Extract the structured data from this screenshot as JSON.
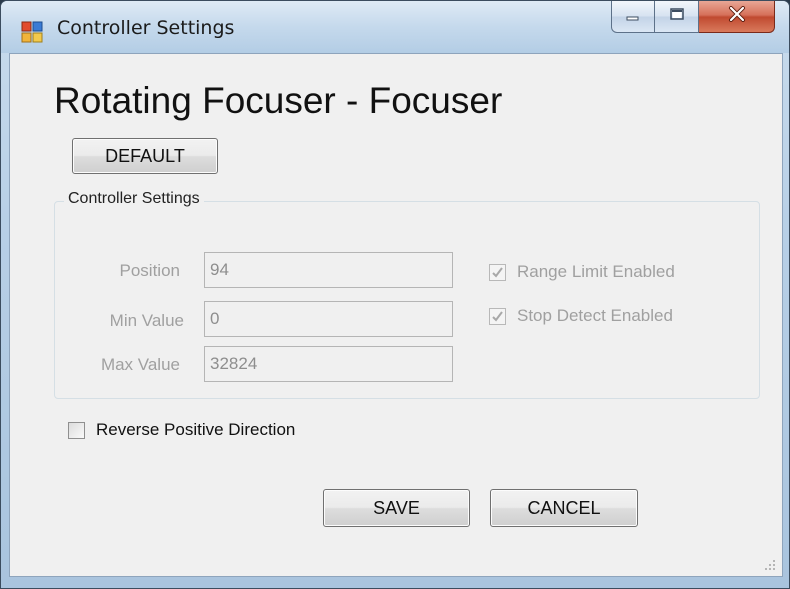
{
  "window": {
    "title": "Controller Settings"
  },
  "main": {
    "heading": "Rotating Focuser - Focuser",
    "default_label": "DEFAULT",
    "group_title": "Controller Settings",
    "fields": [
      {
        "label": "Position",
        "value": "94"
      },
      {
        "label": "Min Value",
        "value": "0"
      },
      {
        "label": "Max Value",
        "value": "32824"
      }
    ],
    "checks": [
      {
        "label": "Range Limit Enabled",
        "checked": true,
        "enabled": false
      },
      {
        "label": "Stop Detect Enabled",
        "checked": true,
        "enabled": false
      }
    ],
    "reverse": {
      "label": "Reverse Positive Direction",
      "checked": false
    },
    "save_label": "SAVE",
    "cancel_label": "CANCEL"
  },
  "icons": [
    "app-icon",
    "minimize-icon",
    "maximize-icon",
    "close-icon",
    "checkmark-icon",
    "resize-grip-icon"
  ],
  "colors": {
    "close_button": "#c8553a",
    "disabled_text": "#a0a0a0",
    "dialog_background": "#f0f0f0"
  }
}
